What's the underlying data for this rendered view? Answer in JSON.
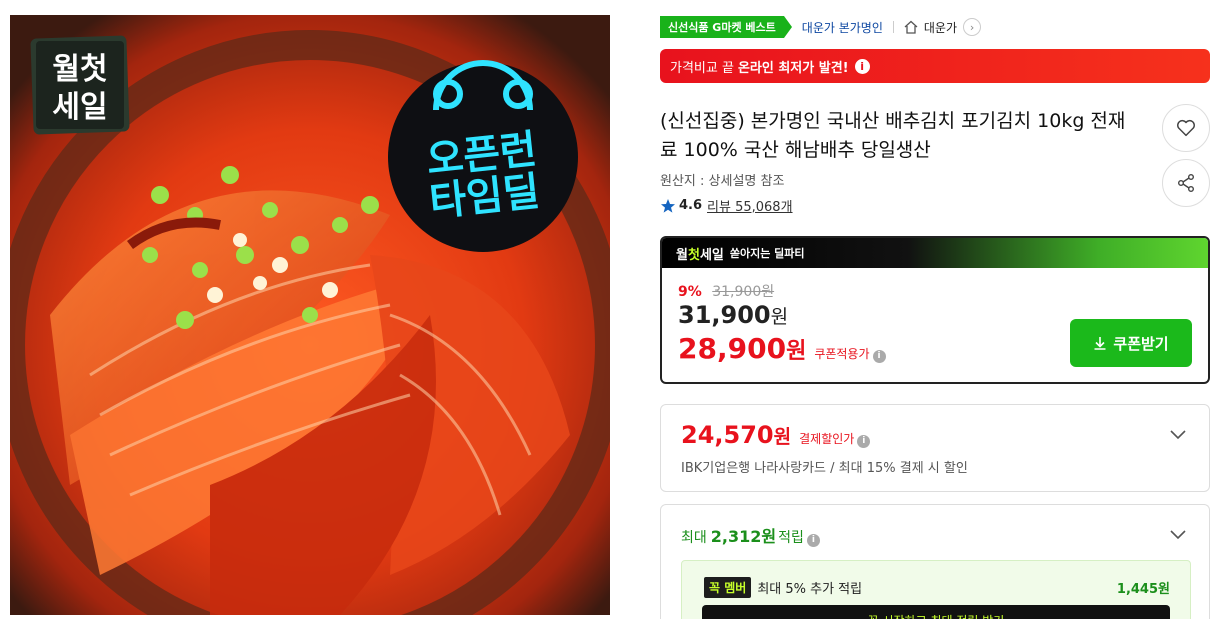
{
  "image": {
    "badge_left_line1": "월첫",
    "badge_left_line2": "세일",
    "badge_right_line1": "오픈런",
    "badge_right_line2": "타임딜"
  },
  "breadcrumb": {
    "badge": "신선식품 G마켓 베스트",
    "brand": "대운가 본가명인",
    "store": "대운가",
    "arrow": "›"
  },
  "compare_banner": {
    "prefix": "가격비교 끝",
    "highlight": "온라인 최저가 발견!",
    "icon": "i"
  },
  "product": {
    "title": "(신선집중) 본가명인 국내산 배추김치 포기김치 10kg 전재료 100% 국산 해남배추 당일생산",
    "origin": "원산지 : 상세설명 참조",
    "rating": "4.6",
    "reviews": "리뷰 55,068개"
  },
  "deal": {
    "head_brand": "월첫세일",
    "head_brand_a": "월",
    "head_brand_b": "첫",
    "head_brand_c": "세일",
    "head_sub": "쏟아지는 딜파티",
    "discount_pct": "9%",
    "original_price": "31,900원",
    "price": "31,900",
    "price_unit": "원",
    "coupon_price": "28,900",
    "coupon_unit": "원",
    "coupon_label": "쿠폰적용가",
    "coupon_button": "쿠폰받기"
  },
  "card_discount": {
    "price": "24,570",
    "unit": "원",
    "label": "결제할인가",
    "desc": "IBK기업은행 나라사랑카드 / 최대 15% 결제 시 할인"
  },
  "points": {
    "prefix": "최대",
    "amount": "2,312원",
    "suffix": "적립",
    "member_tag": "꼭 멤버",
    "member_text": "최대 5% 추가 적립",
    "member_amount": "1,445원",
    "member_button": "꼭 시작하고 최대 적립 받기"
  },
  "colors": {
    "accent_red": "#e8121d",
    "accent_green": "#1bb91b"
  },
  "icons": [
    "home-icon",
    "heart-icon",
    "share-icon",
    "download-icon",
    "chevron-down-icon",
    "info-icon",
    "star-icon"
  ]
}
